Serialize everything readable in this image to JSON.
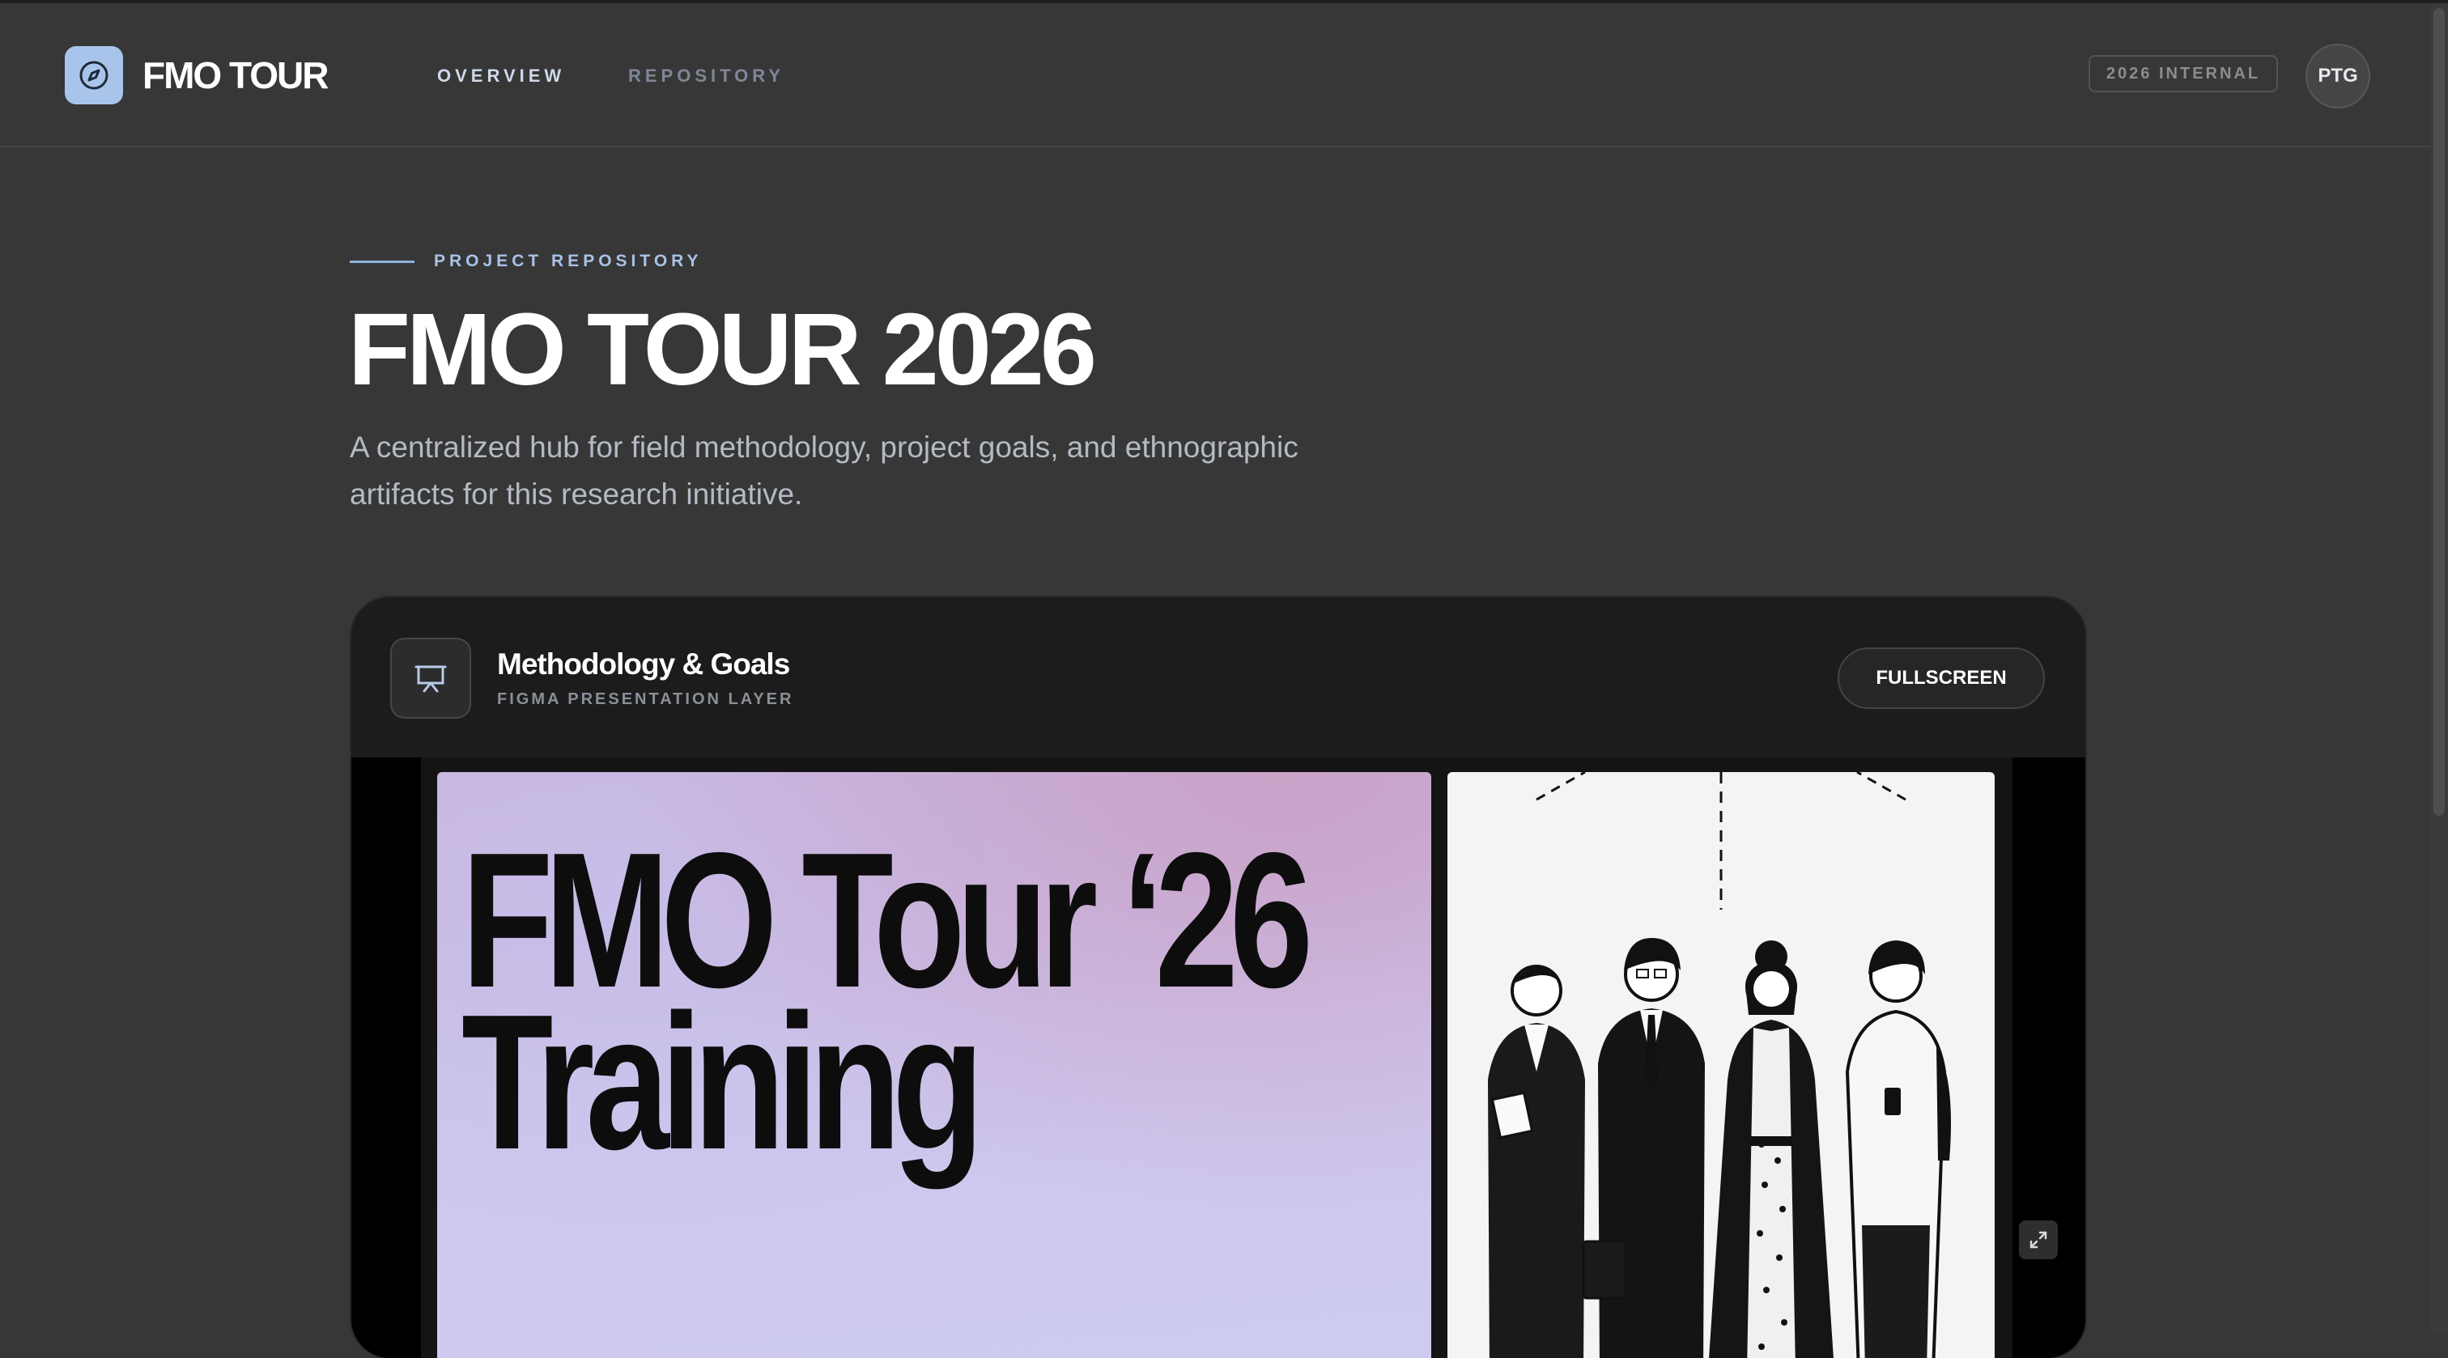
{
  "app": {
    "brand": "FMO TOUR",
    "logo_icon": "compass-icon"
  },
  "nav": {
    "items": [
      {
        "label": "OVERVIEW",
        "active": true
      },
      {
        "label": "REPOSITORY",
        "active": false
      }
    ]
  },
  "header_right": {
    "badge": "2026 INTERNAL",
    "avatar_initials": "PTG"
  },
  "hero": {
    "eyebrow": "PROJECT REPOSITORY",
    "title": "FMO TOUR 2026",
    "description": "A centralized hub for field methodology, project goals, and ethnographic artifacts for this research initiative."
  },
  "card": {
    "icon": "presentation-icon",
    "title": "Methodology & Goals",
    "subtitle": "FIGMA PRESENTATION LAYER",
    "fullscreen_label": "FULLSCREEN",
    "expand_icon": "expand-icon"
  },
  "slide": {
    "title_line1": "FMO Tour ‘26",
    "title_line2": "Training",
    "illustration": "four-people-illustration"
  },
  "colors": {
    "page_bg": "#373737",
    "card_bg": "#1c1c1c",
    "accent": "#a8c4ea",
    "muted_text": "#b4bac4"
  }
}
